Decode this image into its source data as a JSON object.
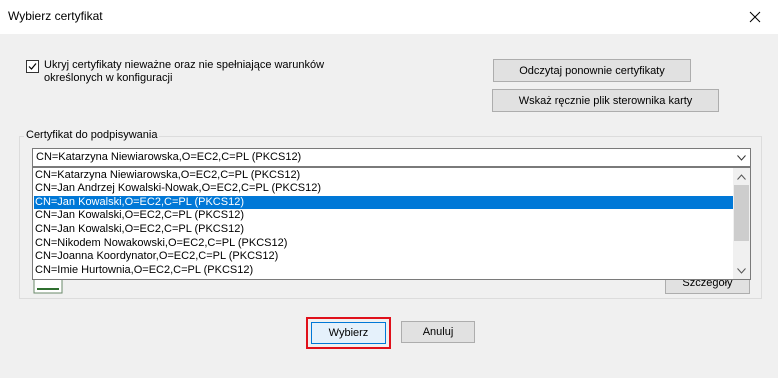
{
  "window": {
    "title": "Wybierz certyfikat"
  },
  "options": {
    "hide_invalid_checked": true,
    "hide_invalid_label": "Ukryj certyfikaty nieważne oraz nie spełniające warunków określonych w konfiguracji"
  },
  "buttons": {
    "reload": "Odczytaj ponownie certyfikaty",
    "driver": "Wskaż ręcznie plik sterownika karty",
    "details": "Szczegóły",
    "select": "Wybierz",
    "cancel": "Anuluj"
  },
  "group": {
    "legend": "Certyfikat do podpisywania"
  },
  "combo": {
    "value": "CN=Katarzyna Niewiarowska,O=EC2,C=PL (PKCS12)",
    "items": [
      "CN=Katarzyna Niewiarowska,O=EC2,C=PL (PKCS12)",
      "CN=Jan Andrzej Kowalski-Nowak,O=EC2,C=PL (PKCS12)",
      "CN=Jan Kowalski,O=EC2,C=PL (PKCS12)",
      "CN=Jan Kowalski,O=EC2,C=PL (PKCS12)",
      "CN=Jan Kowalski,O=EC2,C=PL (PKCS12)",
      "CN=Nikodem Nowakowski,O=EC2,C=PL (PKCS12)",
      "CN=Joanna Koordynator,O=EC2,C=PL (PKCS12)",
      "CN=Imie Hurtownia,O=EC2,C=PL (PKCS12)"
    ],
    "selected_index": 2
  },
  "colors": {
    "selection": "#0078d7",
    "highlight_border": "#e0101a"
  },
  "icons": {
    "close": "close-icon",
    "checkbox": "checkmark-icon",
    "combo_arrow": "chevron-down-icon",
    "scroll_up": "chevron-up-icon",
    "scroll_down": "chevron-down-icon",
    "certificate": "certificate-document-icon"
  }
}
